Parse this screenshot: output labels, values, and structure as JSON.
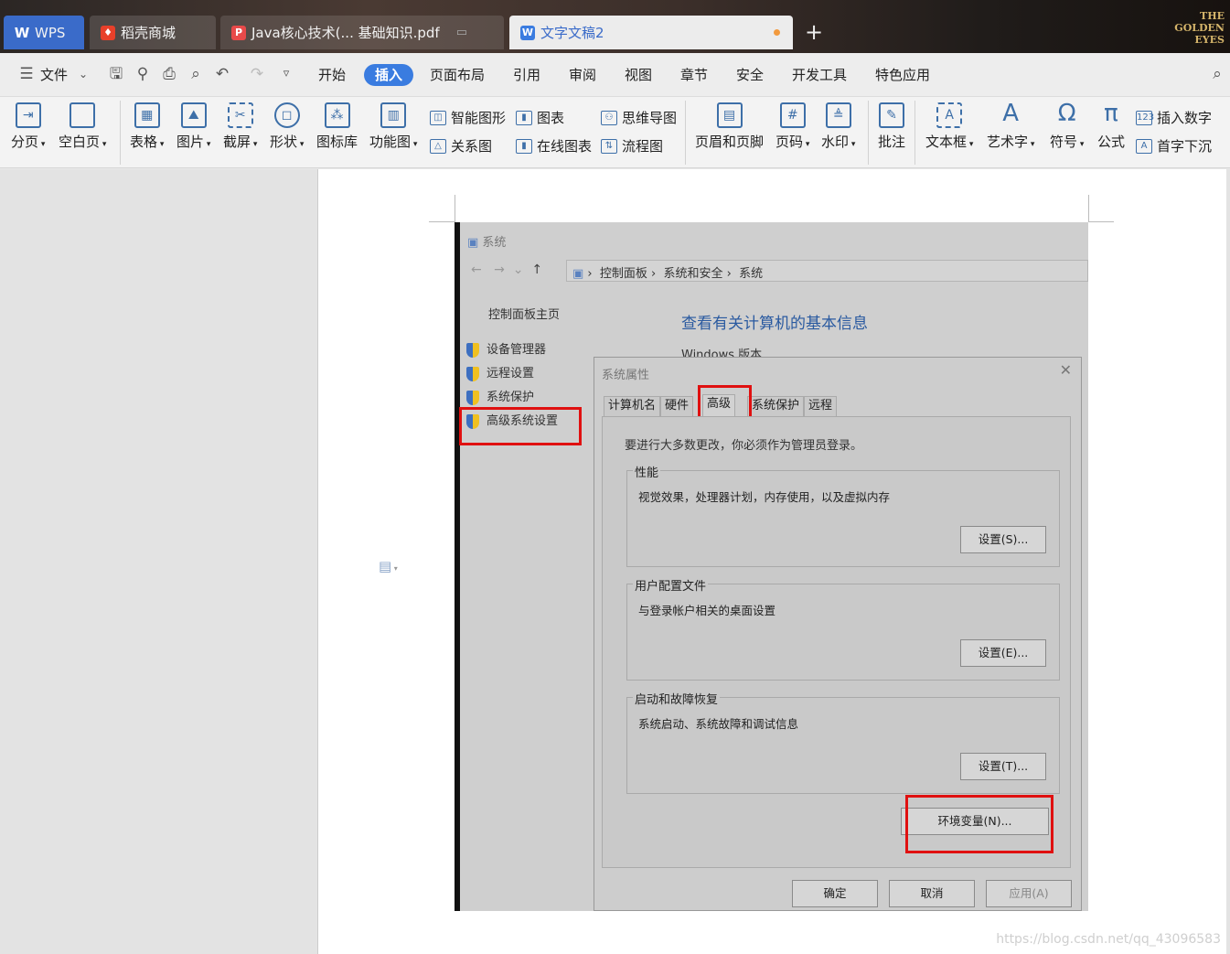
{
  "tabs": [
    {
      "label": "WPS",
      "icon": "wps-logo-icon"
    },
    {
      "label": "稻壳商城",
      "icon": "docer-icon"
    },
    {
      "label": "Java核心技术(... 基础知识.pdf",
      "icon": "pdf-icon"
    },
    {
      "label": "文字文稿2",
      "icon": "word-doc-icon",
      "active": true
    }
  ],
  "logo": {
    "line1": "THE",
    "line2": "GOLDEN",
    "line3": "EYES"
  },
  "menu": {
    "file": "文件",
    "items": [
      "开始",
      "插入",
      "页面布局",
      "引用",
      "审阅",
      "视图",
      "章节",
      "安全",
      "开发工具",
      "特色应用"
    ],
    "active": "插入"
  },
  "ribbon": {
    "page_break": "分页",
    "blank_page": "空白页",
    "table": "表格",
    "picture": "图片",
    "screenshot": "截屏",
    "shape": "形状",
    "icon_lib": "图标库",
    "function_chart": "功能图",
    "smart_art": "智能图形",
    "chart": "图表",
    "mind_map": "思维导图",
    "relation": "关系图",
    "online_chart": "在线图表",
    "flowchart": "流程图",
    "header_footer": "页眉和页脚",
    "page_number": "页码",
    "watermark": "水印",
    "comment": "批注",
    "textbox": "文本框",
    "wordart": "艺术字",
    "symbol": "符号",
    "formula": "公式",
    "insert_number": "插入数字",
    "drop_cap": "首字下沉"
  },
  "screenshot": {
    "window_title": "系统",
    "breadcrumb": [
      "控制面板",
      "系统和安全",
      "系统"
    ],
    "left_nav": {
      "home": "控制面板主页",
      "items": [
        "设备管理器",
        "远程设置",
        "系统保护",
        "高级系统设置"
      ]
    },
    "heading": "查看有关计算机的基本信息",
    "windows_version": "Windows 版本",
    "dialog": {
      "title": "系统属性",
      "tabs": [
        "计算机名",
        "硬件",
        "高级",
        "系统保护",
        "远程"
      ],
      "notice": "要进行大多数更改，你必须作为管理员登录。",
      "groups": [
        {
          "title": "性能",
          "desc": "视觉效果，处理器计划，内存使用，以及虚拟内存",
          "button": "设置(S)..."
        },
        {
          "title": "用户配置文件",
          "desc": "与登录帐户相关的桌面设置",
          "button": "设置(E)..."
        },
        {
          "title": "启动和故障恢复",
          "desc": "系统启动、系统故障和调试信息",
          "button": "设置(T)..."
        }
      ],
      "env_button": "环境变量(N)...",
      "ok": "确定",
      "cancel": "取消",
      "apply": "应用(A)"
    }
  },
  "watermark": "https://blog.csdn.net/qq_43096583",
  "colors": {
    "accent": "#3a7ce0",
    "highlight": "#e01010"
  }
}
